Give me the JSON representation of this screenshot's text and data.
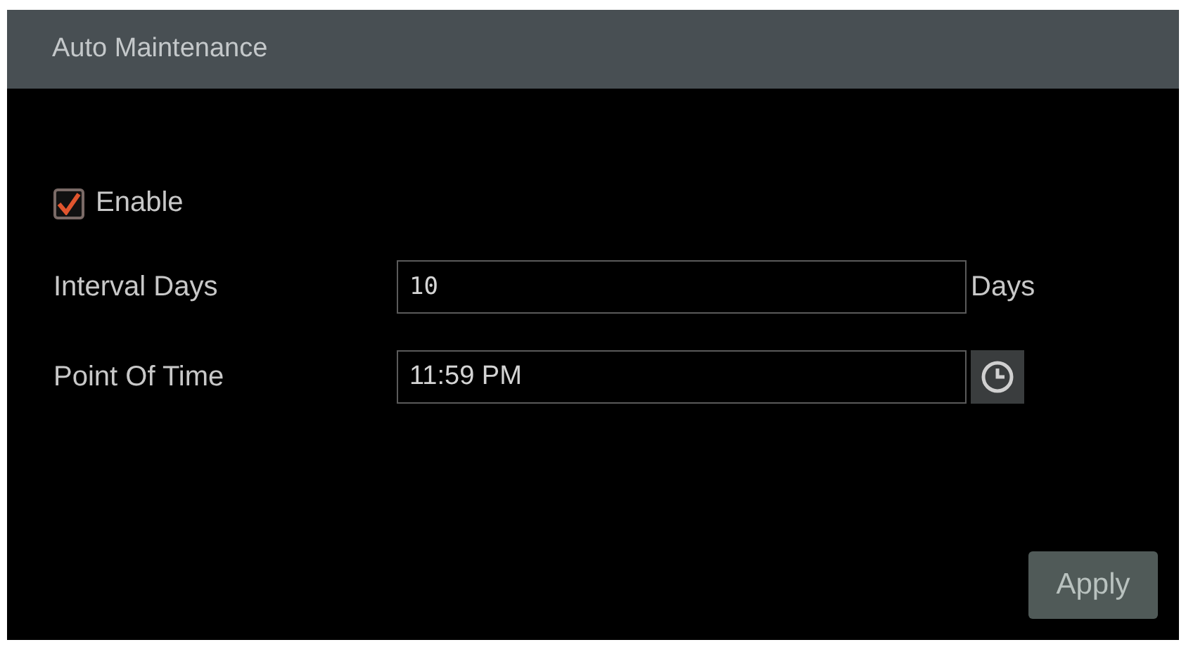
{
  "panel": {
    "title": "Auto Maintenance"
  },
  "enable": {
    "label": "Enable",
    "checked": true
  },
  "fields": [
    {
      "label": "Interval Days",
      "value": "10",
      "kind": "unit",
      "unit": "Days"
    },
    {
      "label": "Point Of Time",
      "value": "11:59 PM",
      "kind": "time"
    }
  ],
  "buttons": [
    "Apply"
  ]
}
